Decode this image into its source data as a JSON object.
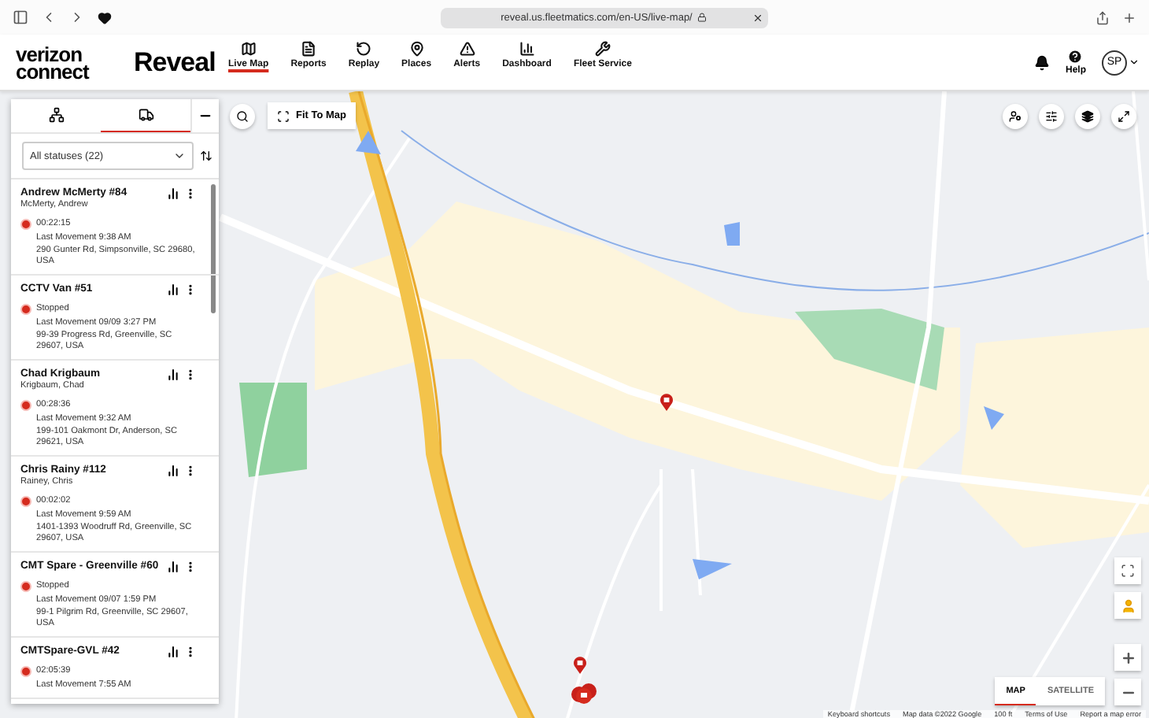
{
  "browser": {
    "url": "reveal.us.fleetmatics.com/en-US/live-map/"
  },
  "app": {
    "logo": [
      "verizon",
      "connect"
    ],
    "product": "Reveal",
    "nav": [
      {
        "label": "Live Map",
        "selected": true
      },
      {
        "label": "Reports",
        "selected": false
      },
      {
        "label": "Replay",
        "selected": false
      },
      {
        "label": "Places",
        "selected": false
      },
      {
        "label": "Alerts",
        "selected": false
      },
      {
        "label": "Dashboard",
        "selected": false
      },
      {
        "label": "Fleet Service",
        "selected": false
      }
    ],
    "help": "Help",
    "avatar": "SP"
  },
  "panel": {
    "tabs": [
      {
        "selected": false
      },
      {
        "selected": true
      }
    ],
    "filter": "All statuses (22)",
    "vehicles": [
      {
        "name": "Andrew McMerty #84",
        "driver": "McMerty, Andrew",
        "status": "00:22:15",
        "last_movement": "Last Movement 9:38 AM",
        "address": "290 Gunter Rd, Simpsonville, SC 29680, USA"
      },
      {
        "name": "CCTV Van #51",
        "status": "Stopped",
        "last_movement": "Last Movement 09/09 3:27 PM",
        "address": "99-39 Progress Rd, Greenville, SC 29607, USA"
      },
      {
        "name": "Chad Krigbaum",
        "driver": "Krigbaum, Chad",
        "status": "00:28:36",
        "last_movement": "Last Movement 9:32 AM",
        "address": "199-101 Oakmont Dr, Anderson, SC 29621, USA"
      },
      {
        "name": "Chris Rainy #112",
        "driver": "Rainey, Chris",
        "status": "00:02:02",
        "last_movement": "Last Movement 9:59 AM",
        "address": "1401-1393 Woodruff Rd, Greenville, SC 29607, USA"
      },
      {
        "name": "CMT Spare - Greenville #60",
        "status": "Stopped",
        "last_movement": "Last Movement 09/07 1:59 PM",
        "address": "99-1 Pilgrim Rd, Greenville, SC 29607, USA"
      },
      {
        "name": "CMTSpare-GVL #42",
        "status": "02:05:39",
        "last_movement": "Last Movement 7:55 AM"
      }
    ]
  },
  "map": {
    "fit_button": "Fit To Map",
    "map_types": [
      {
        "label": "MAP",
        "selected": true
      },
      {
        "label": "SATELLITE",
        "selected": false
      }
    ],
    "attribution": [
      "Keyboard shortcuts",
      "Map data ©2022 Google",
      "100 ft",
      "Terms of Use",
      "Report a map error"
    ]
  }
}
